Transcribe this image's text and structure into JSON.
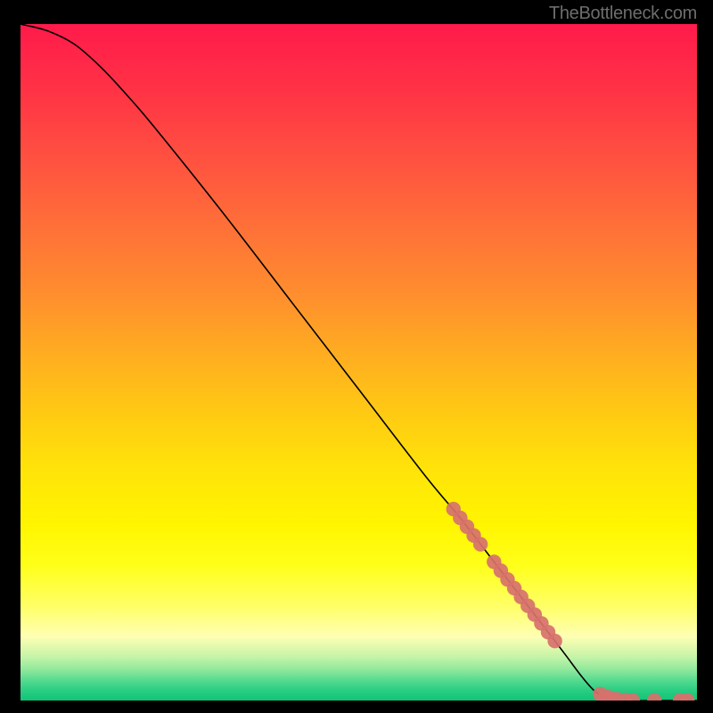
{
  "attribution": "TheBottleneck.com",
  "chart_data": {
    "type": "line",
    "title": "",
    "xlabel": "",
    "ylabel": "",
    "xlim": [
      0,
      100
    ],
    "ylim": [
      0,
      100
    ],
    "grid": false,
    "curve": {
      "description": "Performance/bottleneck curve descending from top-left, nearly linear through middle, flattening to zero at right",
      "points": [
        {
          "x": 0,
          "y": 100
        },
        {
          "x": 4,
          "y": 99
        },
        {
          "x": 8,
          "y": 97
        },
        {
          "x": 12,
          "y": 93.5
        },
        {
          "x": 16,
          "y": 89.2
        },
        {
          "x": 20,
          "y": 84.5
        },
        {
          "x": 30,
          "y": 72
        },
        {
          "x": 40,
          "y": 59
        },
        {
          "x": 50,
          "y": 46
        },
        {
          "x": 60,
          "y": 33
        },
        {
          "x": 65,
          "y": 27
        },
        {
          "x": 70,
          "y": 20.5
        },
        {
          "x": 75,
          "y": 14
        },
        {
          "x": 80,
          "y": 7.5
        },
        {
          "x": 83,
          "y": 3.5
        },
        {
          "x": 85,
          "y": 1.3
        },
        {
          "x": 87,
          "y": 0.3
        },
        {
          "x": 90,
          "y": 0
        },
        {
          "x": 95,
          "y": 0
        },
        {
          "x": 100,
          "y": 0
        }
      ]
    },
    "markers": {
      "description": "Highlighted data points (salmon dots) along the lower-right portion of the curve",
      "color": "#d7716d",
      "points": [
        {
          "x": 64,
          "y": 28.3
        },
        {
          "x": 65,
          "y": 27.0
        },
        {
          "x": 66,
          "y": 25.7
        },
        {
          "x": 67,
          "y": 24.4
        },
        {
          "x": 68,
          "y": 23.1
        },
        {
          "x": 70,
          "y": 20.5
        },
        {
          "x": 71,
          "y": 19.2
        },
        {
          "x": 72,
          "y": 17.9
        },
        {
          "x": 73,
          "y": 16.6
        },
        {
          "x": 74,
          "y": 15.3
        },
        {
          "x": 75,
          "y": 14.0
        },
        {
          "x": 76,
          "y": 12.7
        },
        {
          "x": 77,
          "y": 11.4
        },
        {
          "x": 78,
          "y": 10.1
        },
        {
          "x": 79,
          "y": 8.8
        },
        {
          "x": 85.7,
          "y": 0.95
        },
        {
          "x": 86.5,
          "y": 0.6
        },
        {
          "x": 87.3,
          "y": 0.35
        },
        {
          "x": 88.2,
          "y": 0.18
        },
        {
          "x": 89.4,
          "y": 0.05
        },
        {
          "x": 90.5,
          "y": 0.0
        },
        {
          "x": 93.7,
          "y": 0.0
        },
        {
          "x": 97.5,
          "y": 0.0
        },
        {
          "x": 98.6,
          "y": 0.0
        }
      ]
    },
    "background_gradient": {
      "stops": [
        {
          "offset": 0.0,
          "color": "#ff1a4b"
        },
        {
          "offset": 0.1,
          "color": "#ff3345"
        },
        {
          "offset": 0.2,
          "color": "#ff5140"
        },
        {
          "offset": 0.3,
          "color": "#ff7038"
        },
        {
          "offset": 0.4,
          "color": "#ff8e2e"
        },
        {
          "offset": 0.5,
          "color": "#ffb11f"
        },
        {
          "offset": 0.58,
          "color": "#ffcb12"
        },
        {
          "offset": 0.66,
          "color": "#ffe409"
        },
        {
          "offset": 0.74,
          "color": "#fff500"
        },
        {
          "offset": 0.8,
          "color": "#ffff1a"
        },
        {
          "offset": 0.86,
          "color": "#ffff66"
        },
        {
          "offset": 0.905,
          "color": "#ffffb3"
        },
        {
          "offset": 0.935,
          "color": "#c6f4a8"
        },
        {
          "offset": 0.955,
          "color": "#8de89c"
        },
        {
          "offset": 0.972,
          "color": "#4fd98e"
        },
        {
          "offset": 0.986,
          "color": "#27cd82"
        },
        {
          "offset": 1.0,
          "color": "#10c478"
        }
      ]
    }
  }
}
